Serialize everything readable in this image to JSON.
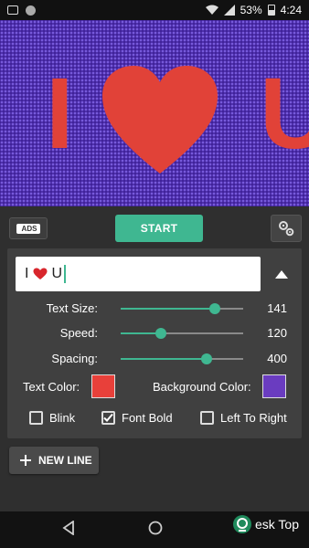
{
  "status_bar": {
    "battery": "53%",
    "time": "4:24",
    "icons": [
      "mail-icon",
      "record-icon",
      "wifi-icon",
      "signal-icon",
      "battery-icon"
    ]
  },
  "preview": {
    "text_left": "I",
    "text_right": "U",
    "heart_icon": "heart-icon",
    "text_color": "#e14238",
    "background_color": "#6a47c6"
  },
  "toolbar": {
    "ads_label": "ADS",
    "start_label": "START",
    "settings_icon": "gear-icon"
  },
  "editor": {
    "text_before": "I",
    "text_after": "U",
    "collapse_icon": "triangle-up-icon"
  },
  "sliders": [
    {
      "label": "Text Size:",
      "value": "141",
      "fraction": 0.77
    },
    {
      "label": "Speed:",
      "value": "120",
      "fraction": 0.33
    },
    {
      "label": "Spacing:",
      "value": "400",
      "fraction": 0.7
    }
  ],
  "colors": {
    "text_label": "Text Color:",
    "text_value": "#e8403a",
    "background_label": "Background Color:",
    "background_value": "#6a3cc0"
  },
  "options": [
    {
      "label": "Blink",
      "checked": false
    },
    {
      "label": "Font Bold",
      "checked": true
    },
    {
      "label": "Left To Right",
      "checked": false
    }
  ],
  "new_line_label": "NEW LINE",
  "watermark": "esk Top",
  "accent": "#3fb791"
}
